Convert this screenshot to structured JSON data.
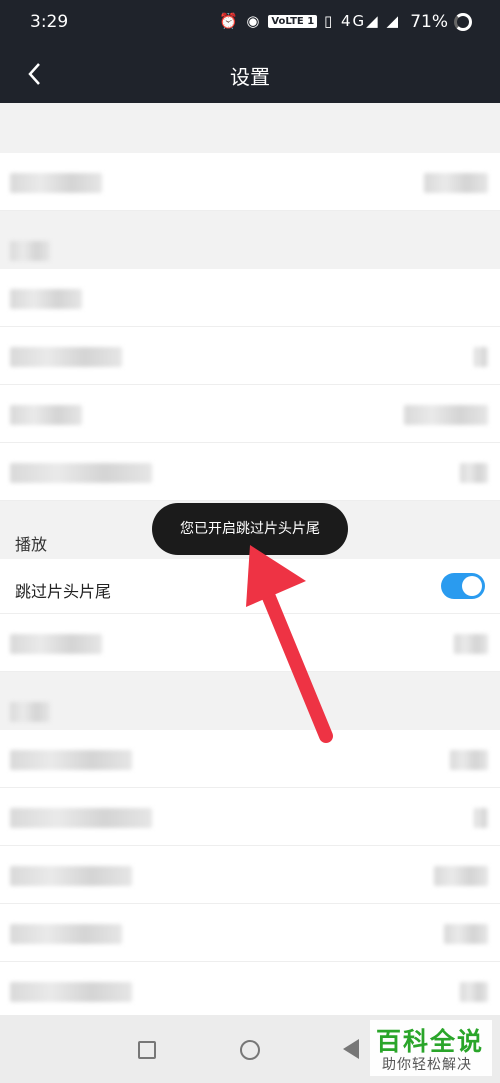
{
  "status_bar": {
    "time": "3:29",
    "icons_text": "⏰ ◉",
    "volte": "VoLTE 1",
    "signal": "▯ 4G◢ ◢",
    "battery": "71%"
  },
  "header": {
    "title": "设置",
    "back_icon": "back-arrow-icon"
  },
  "section_play": {
    "title": "播放"
  },
  "skip_row": {
    "label": "跳过片头片尾",
    "toggle_on": true
  },
  "toast": {
    "text": "您已开启跳过片头片尾"
  },
  "colors": {
    "toggle_accent": "#2a9bef",
    "header_bg": "#1f232b",
    "arrow": "#ee3344",
    "watermark_green": "#2aa52a"
  },
  "watermark": {
    "line1": "百科全说",
    "line2": "助你轻松解决"
  }
}
